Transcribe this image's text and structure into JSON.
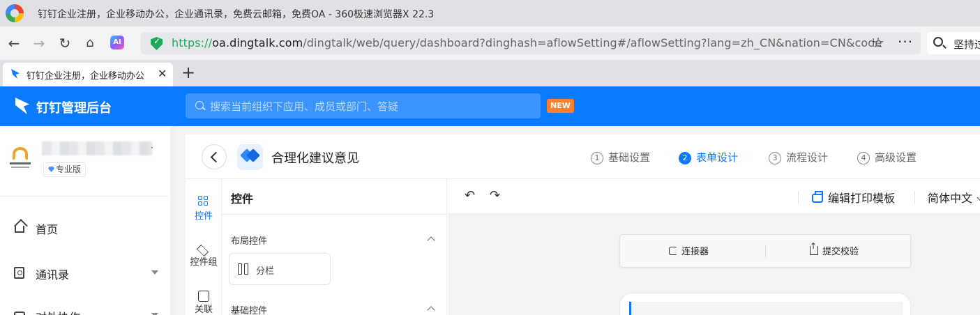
{
  "browser": {
    "window_title": "钉钉企业注册，企业移动办公，企业通讯录，免费云邮箱，免费OA - 360极速浏览器X 22.3",
    "url_protocol": "https://",
    "url_host": "oa.dingtalk.com",
    "url_path": "/dingtalk/web/query/dashboard?dinghash=aflowSetting#/aflowSetting?lang=zh_CN&nation=CN&code",
    "ai_label": "AI",
    "search_text": "坚持过",
    "tab_title": "钉钉企业注册，企业移动办公",
    "icons": [
      "back-icon",
      "forward-icon",
      "reload-icon",
      "home-icon",
      "star-icon",
      "more-icon",
      "close-icon",
      "plus-icon"
    ]
  },
  "header": {
    "title": "钉钉管理后台",
    "search_placeholder": "搜索当前组织下应用、成员或部门、答疑",
    "new_badge": "NEW",
    "color": "#0a7aff"
  },
  "sidebar": {
    "org_suffix": "·",
    "edition": "专业版",
    "items": [
      {
        "label": "首页",
        "icon": "home-icon"
      },
      {
        "label": "通讯录",
        "icon": "contacts-icon",
        "expandable": true
      },
      {
        "label": "对外协作",
        "icon": "external-icon",
        "expandable": true
      }
    ]
  },
  "designer": {
    "form_title": "合理化建议意见",
    "steps": [
      {
        "num": "1",
        "label": "基础设置",
        "active": false
      },
      {
        "num": "2",
        "label": "表单设计",
        "active": true
      },
      {
        "num": "3",
        "label": "流程设计",
        "active": false
      },
      {
        "num": "4",
        "label": "高级设置",
        "active": false
      }
    ],
    "rail": [
      {
        "label": "控件",
        "active": true
      },
      {
        "label": "控件组",
        "active": false
      },
      {
        "label": "关联",
        "active": false
      }
    ],
    "panel": {
      "title": "控件",
      "groups": [
        {
          "title": "布局控件",
          "widgets": [
            "分栏"
          ]
        },
        {
          "title": "基础控件",
          "widgets": []
        }
      ]
    },
    "toolbar": {
      "print_template": "编辑打印模板",
      "language": "简体中文"
    },
    "canvas_actions": {
      "connector": "连接器",
      "submit_check": "提交校验"
    }
  }
}
